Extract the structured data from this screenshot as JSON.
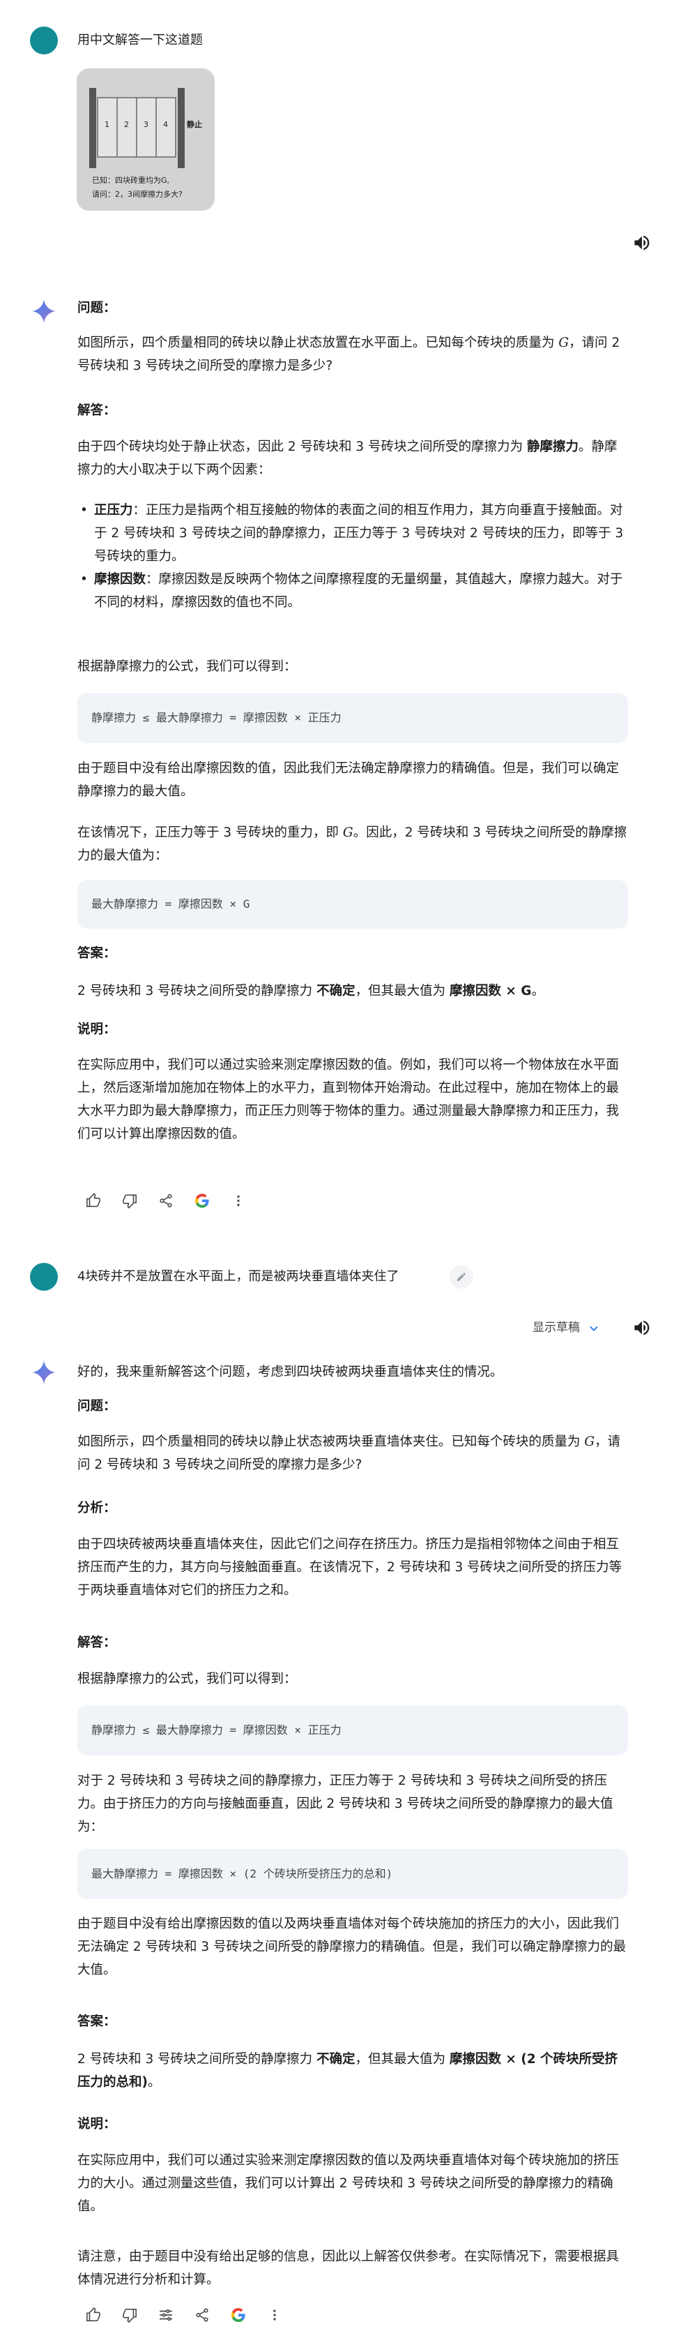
{
  "turn1": {
    "prompt": "用中文解答一下这道题",
    "image": {
      "labels": [
        "1",
        "2",
        "3",
        "4"
      ],
      "side_label": "静止",
      "line1": "已知：四块砖重均为G,",
      "line2": "请问：2，3间摩擦力多大?"
    }
  },
  "answer1": {
    "h_question": "问题：",
    "question_a": "如图所示，四个质量相同的砖块以静止状态放置在水平面上。已知每个砖块的质量为 ",
    "question_var": "G",
    "question_b": "，请问 2 号砖块和 3 号砖块之间所受的摩擦力是多少?",
    "h_answer": "解答：",
    "intro_a": "由于四个砖块均处于静止状态，因此 2 号砖块和 3 号砖块之间所受的摩擦力为 ",
    "intro_b": "静摩擦力",
    "intro_c": "。静摩擦力的大小取决于以下两个因素：",
    "bullet1_term": "正压力",
    "bullet1_text": "：正压力是指两个相互接触的物体的表面之间的相互作用力，其方向垂直于接触面。对于 2 号砖块和 3 号砖块之间的静摩擦力，正压力等于 3 号砖块对 2 号砖块的压力，即等于 3 号砖块的重力。",
    "bullet2_term": "摩擦因数",
    "bullet2_text": "：摩擦因数是反映两个物体之间摩擦程度的无量纲量，其值越大，摩擦力越大。对于不同的材料，摩擦因数的值也不同。",
    "formula_intro": "根据静摩擦力的公式，我们可以得到：",
    "code1": "静摩擦力 ≤ 最大静摩擦力 = 摩擦因数 × 正压力",
    "para2": "由于题目中没有给出摩擦因数的值，因此我们无法确定静摩擦力的精确值。但是，我们可以确定静摩擦力的最大值。",
    "para3_a": "在该情况下，正压力等于 3 号砖块的重力，即 ",
    "para3_var": "G",
    "para3_b": "。因此，2 号砖块和 3 号砖块之间所受的静摩擦力的最大值为：",
    "code2": "最大静摩擦力 = 摩擦因数 × G",
    "h_result": "答案：",
    "result_a": "2 号砖块和 3 号砖块之间所受的静摩擦力 ",
    "result_b": "不确定",
    "result_c": "，但其最大值为 ",
    "result_d": "摩擦因数 × G",
    "result_e": "。",
    "h_note": "说明：",
    "note": "在实际应用中，我们可以通过实验来测定摩擦因数的值。例如，我们可以将一个物体放在水平面上，然后逐渐增加施加在物体上的水平力，直到物体开始滑动。在此过程中，施加在物体上的最大水平力即为最大静摩擦力，而正压力则等于物体的重力。通过测量最大静摩擦力和正压力，我们可以计算出摩擦因数的值。"
  },
  "turn2": {
    "prompt": "4块砖并不是放置在水平面上，而是被两块垂直墙体夹住了",
    "drafts_label": "显示草稿"
  },
  "answer2": {
    "opening": "好的，我来重新解答这个问题，考虑到四块砖被两块垂直墙体夹住的情况。",
    "h_question": "问题：",
    "question_a": "如图所示，四个质量相同的砖块以静止状态被两块垂直墙体夹住。已知每个砖块的质量为 ",
    "question_var": "G",
    "question_b": "，请问 2 号砖块和 3 号砖块之间所受的摩擦力是多少?",
    "h_analysis": "分析：",
    "analysis": "由于四块砖被两块垂直墙体夹住，因此它们之间存在挤压力。挤压力是指相邻物体之间由于相互挤压而产生的力，其方向与接触面垂直。在该情况下，2 号砖块和 3 号砖块之间所受的挤压力等于两块垂直墙体对它们的挤压力之和。",
    "h_answer": "解答：",
    "formula_intro": "根据静摩擦力的公式，我们可以得到：",
    "code1": "静摩擦力 ≤ 最大静摩擦力 = 摩擦因数 × 正压力",
    "para2": "对于 2 号砖块和 3 号砖块之间的静摩擦力，正压力等于 2 号砖块和 3 号砖块之间所受的挤压力。由于挤压力的方向与接触面垂直，因此 2 号砖块和 3 号砖块之间所受的静摩擦力的最大值为：",
    "code2": "最大静摩擦力 = 摩擦因数 × (2 个砖块所受挤压力的总和)",
    "para3": "由于题目中没有给出摩擦因数的值以及两块垂直墙体对每个砖块施加的挤压力的大小，因此我们无法确定 2 号砖块和 3 号砖块之间所受的静摩擦力的精确值。但是，我们可以确定静摩擦力的最大值。",
    "h_result": "答案：",
    "result_a": "2 号砖块和 3 号砖块之间所受的静摩擦力 ",
    "result_b": "不确定",
    "result_c": "，但其最大值为 ",
    "result_d": "摩擦因数 × (2 个砖块所受挤压力的总和)",
    "result_e": "。",
    "h_note": "说明：",
    "note": "在实际应用中，我们可以通过实验来测定摩擦因数的值以及两块垂直墙体对每个砖块施加的挤压力的大小。通过测量这些值，我们可以计算出 2 号砖块和 3 号砖块之间所受的静摩擦力的精确值。",
    "disclaimer": "请注意，由于题目中没有给出足够的信息，因此以上解答仅供参考。在实际情况下，需要根据具体情况进行分析和计算。"
  },
  "colors": {
    "avatar": "#128c94",
    "code_bg": "#f0f4f9",
    "spark_blue": "#4285f4",
    "text": "#1f1f1f",
    "icon_gray": "#444746"
  }
}
